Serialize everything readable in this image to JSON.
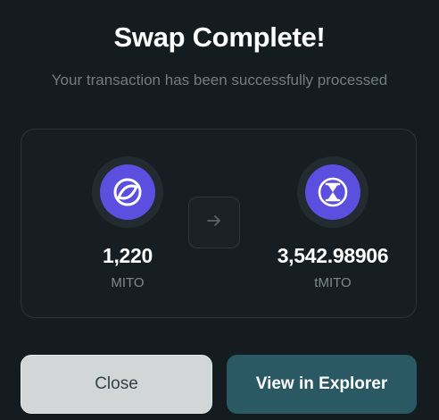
{
  "modal": {
    "title": "Swap Complete!",
    "subtitle": "Your transaction has been successfully processed"
  },
  "swap": {
    "from": {
      "amount": "1,220",
      "symbol": "MITO",
      "icon": "mito-token-icon"
    },
    "to": {
      "amount": "3,542.98906",
      "symbol": "tMITO",
      "icon": "tmito-hourglass-token-icon"
    },
    "arrow_icon": "arrow-right-icon"
  },
  "actions": {
    "close_label": "Close",
    "explorer_label": "View in Explorer"
  },
  "colors": {
    "background": "#151c1f",
    "token_accent": "#5b4fe0",
    "primary_button": "#2a5963",
    "secondary_button": "#d2d6d7"
  }
}
